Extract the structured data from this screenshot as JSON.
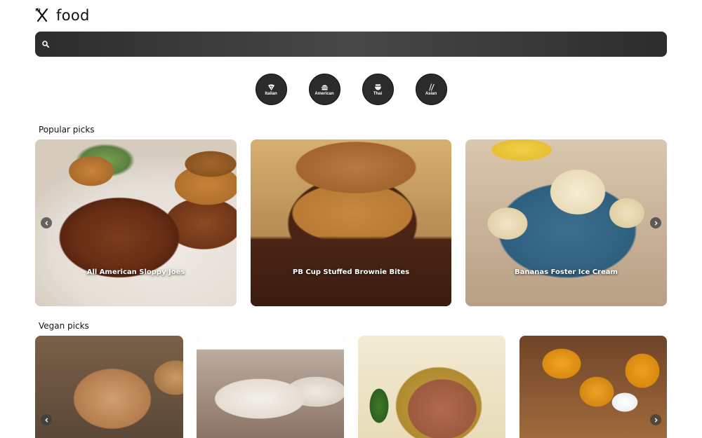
{
  "app": {
    "title": "food"
  },
  "search": {
    "value": "",
    "placeholder": ""
  },
  "categories": [
    {
      "label": "Italian",
      "icon": "pizza-icon"
    },
    {
      "label": "American",
      "icon": "burger-icon"
    },
    {
      "label": "Thai",
      "icon": "noodle-bowl-icon"
    },
    {
      "label": "Asian",
      "icon": "chopsticks-icon"
    }
  ],
  "popular": {
    "title": "Popular picks",
    "items": [
      {
        "label": "All American Sloppy Joes"
      },
      {
        "label": "PB Cup Stuffed Brownie Bites"
      },
      {
        "label": "Bananas Foster Ice Cream"
      }
    ]
  },
  "vegan": {
    "title": "Vegan picks",
    "items": [
      {
        "label": ""
      },
      {
        "label": ""
      },
      {
        "label": ""
      },
      {
        "label": ""
      }
    ]
  },
  "colors": {
    "search_bg": "#3a3a3a",
    "category_bg": "#2b2b2b"
  }
}
